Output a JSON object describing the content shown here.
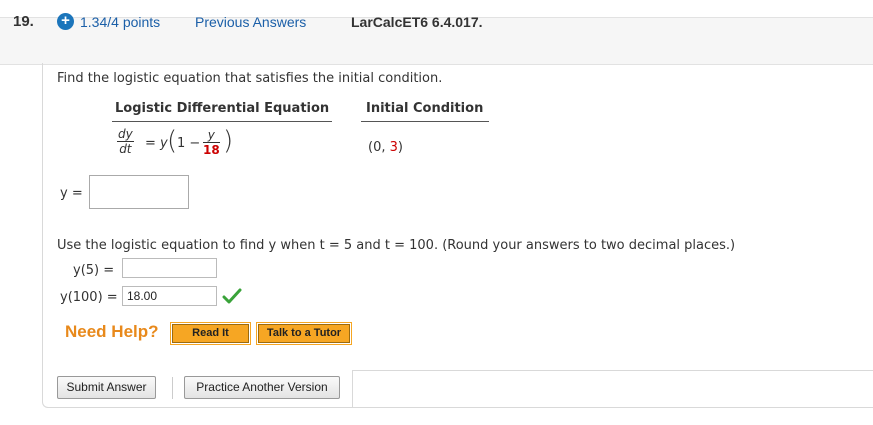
{
  "header": {
    "question_number": "19.",
    "plus_symbol": "+",
    "points": "1.34/4 points",
    "previous_answers": "Previous Answers",
    "reference": "LarCalcET6 6.4.017."
  },
  "problem": {
    "prompt": "Find the logistic equation that satisfies the initial condition.",
    "col_equation_header": "Logistic Differential Equation",
    "col_condition_header": "Initial Condition",
    "eq_dy": "dy",
    "eq_dt": "dt",
    "eq_equals": "=",
    "eq_y": "y",
    "eq_one_minus": "1 −",
    "eq_frac_num": "y",
    "eq_frac_den": "18",
    "condition_open": "(0, ",
    "condition_value": "3",
    "condition_close": ")",
    "y_label": "y =",
    "y_input_value": ""
  },
  "part2": {
    "prompt": "Use the logistic equation to find y when  t = 5  and  t = 100.  (Round your answers to two decimal places.)",
    "y5_label": "y(5) =",
    "y5_value": "",
    "y100_label": "y(100) =",
    "y100_value": "18.00"
  },
  "help": {
    "need_help": "Need Help?",
    "read_it": "Read It",
    "talk_to_tutor": "Talk to a Tutor"
  },
  "actions": {
    "submit": "Submit Answer",
    "practice": "Practice Another Version"
  },
  "colors": {
    "link": "#1b5fa8",
    "accent_red": "#cc0000",
    "need_help": "#e8891b",
    "help_button": "#f6a623",
    "check": "#3aa33a"
  }
}
